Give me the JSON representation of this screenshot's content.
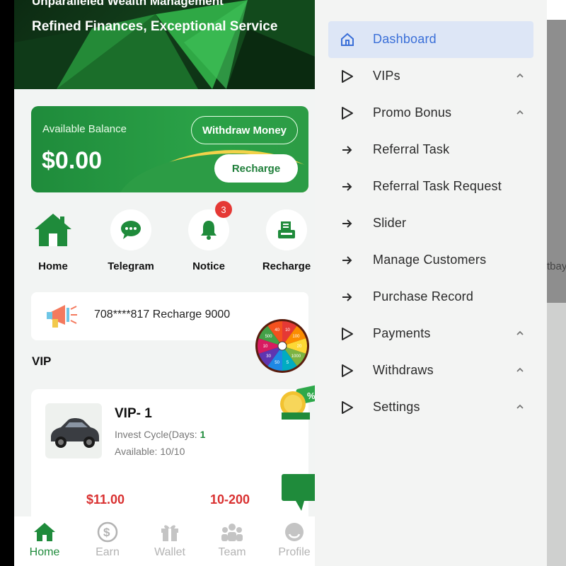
{
  "hero": {
    "tagline_top": "Unparalleled Wealth Management",
    "tagline_main": "Refined Finances, Exceptional Service"
  },
  "balance": {
    "label": "Available Balance",
    "value": "$0.00",
    "withdraw_label": "Withdraw Money",
    "recharge_label": "Recharge"
  },
  "quick_actions": [
    {
      "label": "Home",
      "icon": "home-icon"
    },
    {
      "label": "Telegram",
      "icon": "chat-icon"
    },
    {
      "label": "Notice",
      "icon": "bell-icon",
      "badge": "3"
    },
    {
      "label": "Recharge",
      "icon": "printer-icon"
    }
  ],
  "notice": {
    "text": "708****817 Recharge 9000"
  },
  "vip_section": {
    "title": "VIP",
    "card": {
      "name": "VIP- 1",
      "cycle_label": "Invest Cycle(Days: ",
      "cycle_value": "1",
      "available": "Available: 10/10",
      "price": "$11.00",
      "range": "10-200"
    }
  },
  "wheel": {
    "segments": [
      "10",
      "100",
      "20",
      "1000",
      "5",
      "50",
      "30",
      "10",
      "500",
      "40"
    ]
  },
  "tabbar": [
    {
      "label": "Home",
      "icon": "home-icon",
      "active": true
    },
    {
      "label": "Earn",
      "icon": "dollar-icon",
      "active": false
    },
    {
      "label": "Wallet",
      "icon": "gift-icon",
      "active": false
    },
    {
      "label": "Team",
      "icon": "team-icon",
      "active": false
    },
    {
      "label": "Profile",
      "icon": "profile-icon",
      "active": false
    }
  ],
  "sidebar": {
    "items": [
      {
        "label": "Dashboard",
        "icon": "home-outline-icon",
        "active": true,
        "expandable": false
      },
      {
        "label": "VIPs",
        "icon": "play-outline-icon",
        "active": false,
        "expandable": true
      },
      {
        "label": "Promo Bonus",
        "icon": "play-outline-icon",
        "active": false,
        "expandable": true
      },
      {
        "label": "Referral Task",
        "icon": "arrow-right-icon",
        "active": false,
        "expandable": false
      },
      {
        "label": "Referral Task Request",
        "icon": "arrow-right-icon",
        "active": false,
        "expandable": false
      },
      {
        "label": "Slider",
        "icon": "arrow-right-icon",
        "active": false,
        "expandable": false
      },
      {
        "label": "Manage Customers",
        "icon": "arrow-right-icon",
        "active": false,
        "expandable": false
      },
      {
        "label": "Purchase Record",
        "icon": "arrow-right-icon",
        "active": false,
        "expandable": false
      },
      {
        "label": "Payments",
        "icon": "play-outline-icon",
        "active": false,
        "expandable": true
      },
      {
        "label": "Withdraws",
        "icon": "play-outline-icon",
        "active": false,
        "expandable": true
      },
      {
        "label": "Settings",
        "icon": "play-outline-icon",
        "active": false,
        "expandable": true
      }
    ]
  },
  "background_fragment": "tbay",
  "colors": {
    "brand_green": "#1f8b3b",
    "accent_yellow": "#f2d24a",
    "price_red": "#d93030",
    "badge_red": "#e53935",
    "sidebar_active_bg": "#dde6f6",
    "sidebar_active_text": "#3a6fd8"
  }
}
